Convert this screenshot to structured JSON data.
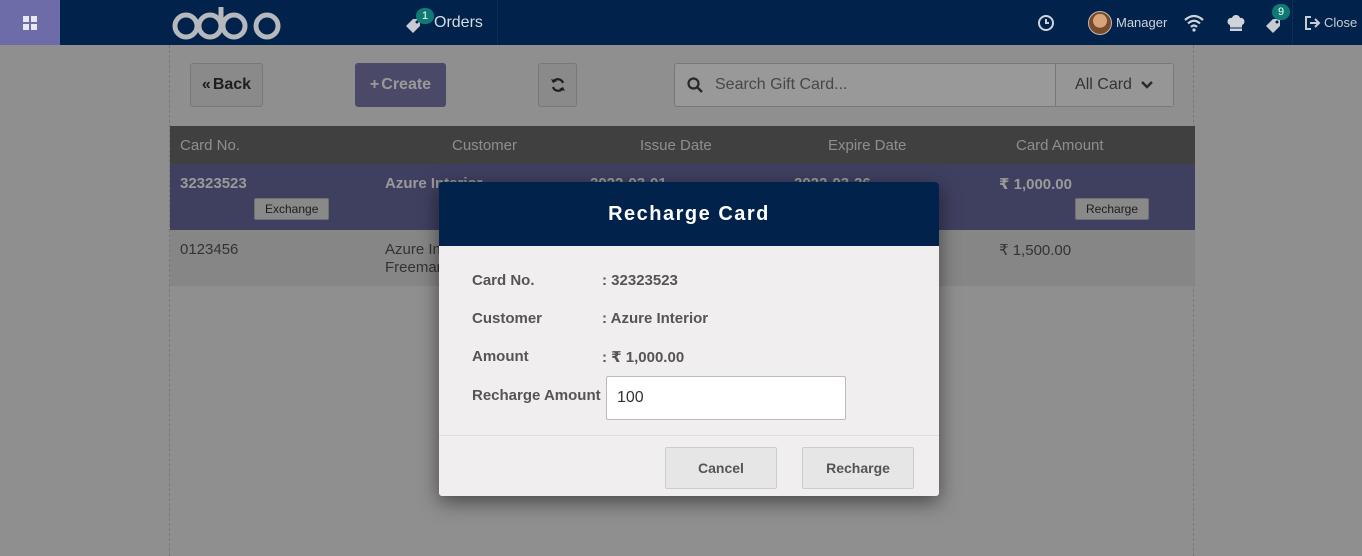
{
  "navbar": {
    "orders_label": "Orders",
    "orders_badge": "1",
    "user_name": "Manager",
    "ticket_badge": "9",
    "close_label": "Close"
  },
  "toolbar": {
    "back_label": "Back",
    "create_label": "Create",
    "search_placeholder": "Search Gift Card...",
    "filter_value": "All Card"
  },
  "table": {
    "headers": [
      "Card No.",
      "Customer",
      "Issue Date",
      "Expire Date",
      "Card Amount"
    ],
    "rows": [
      {
        "card_no": "32323523",
        "customer": "Azure Interior",
        "issue_date": "2022-03-01",
        "expire_date": "2022-03-26",
        "amount": "₹ 1,000.00",
        "action1": "Exchange",
        "action2": "Recharge"
      },
      {
        "card_no": "0123456",
        "customer_line1": "Azure Interior,",
        "customer_line2": "Freeman",
        "amount": "₹ 1,500.00"
      }
    ]
  },
  "modal": {
    "title": "Recharge Card",
    "fields": [
      {
        "label": "Card No.",
        "value": ": 32323523"
      },
      {
        "label": "Customer",
        "value": ": Azure Interior"
      },
      {
        "label": "Amount",
        "value": ": ₹ 1,000.00"
      }
    ],
    "recharge_label": "Recharge Amount",
    "recharge_value": "100",
    "cancel_label": "Cancel",
    "confirm_label": "Recharge"
  },
  "colors": {
    "navbar": "#01234b",
    "accent": "#6e6ca8",
    "badge": "#0f7a73"
  }
}
